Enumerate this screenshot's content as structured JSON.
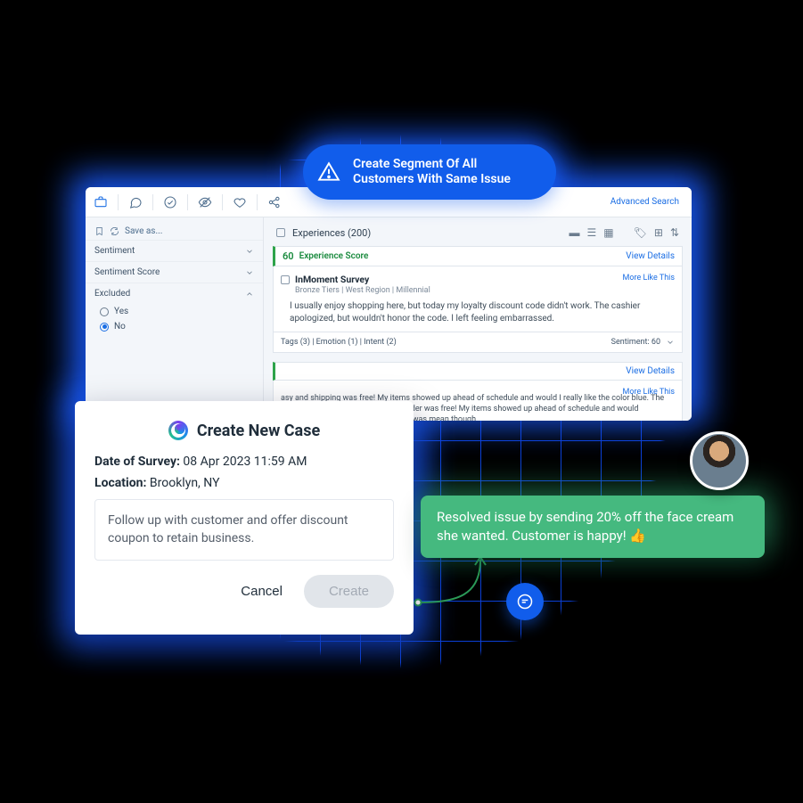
{
  "pill": {
    "text": "Create Segment Of All Customers With Same Issue"
  },
  "toolbar": {
    "advanced_search": "Advanced Search"
  },
  "sidebar": {
    "save_as": "Save as...",
    "sections": [
      {
        "label": "Sentiment",
        "open": false
      },
      {
        "label": "Sentiment Score",
        "open": false
      },
      {
        "label": "Excluded",
        "open": true
      }
    ],
    "excluded_options": {
      "yes": "Yes",
      "no": "No",
      "selected": "no"
    }
  },
  "experiences": {
    "header": "Experiences (200)",
    "score": "60",
    "score_label": "Experience Score",
    "view_details": "View Details",
    "more_like_this": "More Like This",
    "item": {
      "title": "InMoment Survey",
      "subtitle": "Bronze Tiers | West Region | Millennial",
      "body": "I usually enjoy shopping here, but today my loyalty discount code didn't work. The cashier apologized, but wouldn't honor the code. I left feeling embarrassed.",
      "tags": "Tags (3) | Emotion (1) | Intent (2)",
      "sentiment_label": "Sentiment: 60"
    },
    "item2": {
      "snippet": "asy and shipping was free! My items showed up ahead of schedule and would I really like the color blue. The staff was mean though. My online order was free! My items showed up ahead of schedule and would recommend this to or blue. The staff was mean though."
    }
  },
  "modal": {
    "title": "Create New Case",
    "date_label": "Date of Survey:",
    "date_value": "08 Apr 2023 11:59 AM",
    "location_label": "Location:",
    "location_value": "Brooklyn, NY",
    "note": "Follow up with customer and offer discount coupon to retain business.",
    "cancel": "Cancel",
    "create": "Create"
  },
  "bubble": {
    "text": "Resolved issue by sending 20% off the face cream she wanted. Customer is happy!  👍"
  }
}
